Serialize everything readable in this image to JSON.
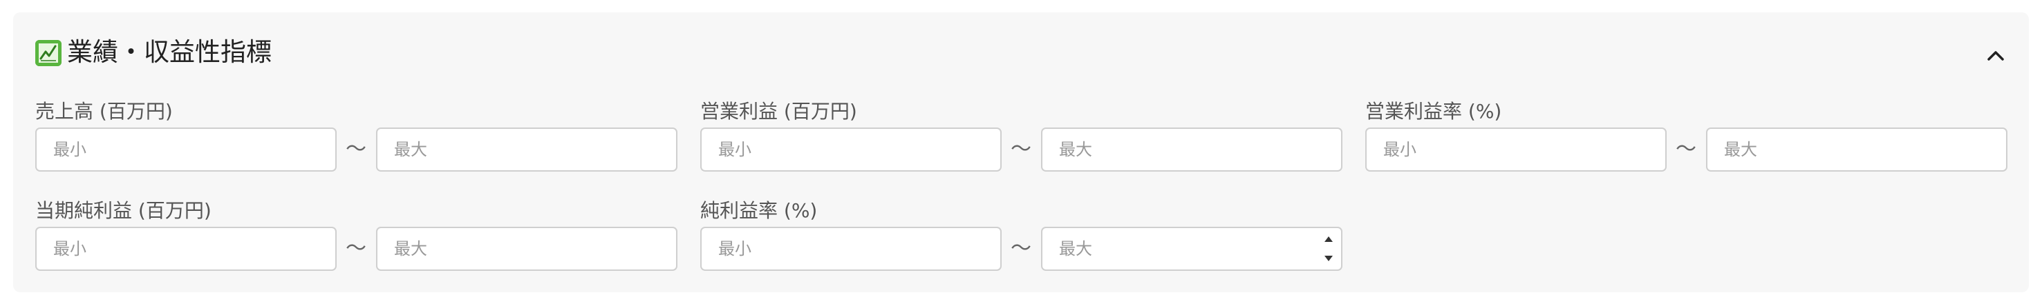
{
  "section": {
    "icon": "chart-increasing-icon",
    "title": "業績・収益性指標",
    "collapse_icon": "chevron-up-icon"
  },
  "fields": [
    {
      "label": "売上高 (百万円)",
      "min_placeholder": "最小",
      "max_placeholder": "最大",
      "separator": "〜"
    },
    {
      "label": "営業利益 (百万円)",
      "min_placeholder": "最小",
      "max_placeholder": "最大",
      "separator": "〜"
    },
    {
      "label": "営業利益率 (%)",
      "min_placeholder": "最小",
      "max_placeholder": "最大",
      "separator": "〜"
    },
    {
      "label": "当期純利益 (百万円)",
      "min_placeholder": "最小",
      "max_placeholder": "最大",
      "separator": "〜"
    },
    {
      "label": "純利益率 (%)",
      "min_placeholder": "最小",
      "max_placeholder": "最大",
      "separator": "〜"
    }
  ],
  "colors": {
    "panel_background": "#f7f7f7",
    "icon_background": "#59b53f",
    "input_border": "#cfcfcf",
    "label_text": "#555555"
  }
}
